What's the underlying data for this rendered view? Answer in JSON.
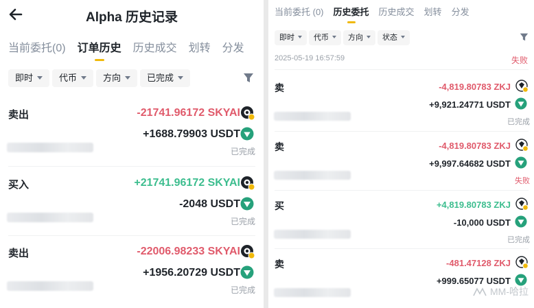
{
  "left": {
    "title": "Alpha 历史记录",
    "tabs": [
      "当前委托(0)",
      "订单历史",
      "历史成交",
      "划转",
      "分发"
    ],
    "active_tab": 1,
    "filters": [
      "即时",
      "代币",
      "方向",
      "已完成"
    ],
    "orders": [
      {
        "side": "卖出",
        "amount": "-21741.96172 SKYAI",
        "usdt": "+1688.79903 USDT",
        "status": "已完成",
        "direction": "sell"
      },
      {
        "side": "买入",
        "amount": "+21741.96172 SKYAI",
        "usdt": "-2048 USDT",
        "status": "已完成",
        "direction": "buy"
      },
      {
        "side": "卖出",
        "amount": "-22006.98233 SKYAI",
        "usdt": "+1956.20729 USDT",
        "status": "已完成",
        "direction": "sell"
      }
    ]
  },
  "right": {
    "tabs": [
      "当前委托 (0)",
      "历史委托",
      "历史成交",
      "划转",
      "分发"
    ],
    "active_tab": 1,
    "filters": [
      "即时",
      "代币",
      "方向",
      "状态"
    ],
    "top_date": "2025-05-19 16:57:59",
    "top_status": "失败",
    "orders": [
      {
        "side": "卖",
        "amount": "-4,819.80783 ZKJ",
        "usdt": "+9,921.24771 USDT",
        "status": "已完成",
        "status_type": "done",
        "direction": "sell"
      },
      {
        "side": "卖",
        "amount": "-4,819.80783 ZKJ",
        "usdt": "+9,997.64682 USDT",
        "status": "失败",
        "status_type": "fail",
        "direction": "sell"
      },
      {
        "side": "买",
        "amount": "+4,819.80783 ZKJ",
        "usdt": "-10,000 USDT",
        "status": "已完成",
        "status_type": "done",
        "direction": "buy"
      },
      {
        "side": "卖",
        "amount": "-481.47128 ZKJ",
        "usdt": "+999.65077 USDT",
        "status": "",
        "status_type": "done",
        "direction": "sell"
      }
    ]
  },
  "watermark": "MM-哈拉",
  "colors": {
    "sell": "#e05a6b",
    "buy": "#3cbd8e",
    "accent": "#f0b90b",
    "muted": "#9aa0a8"
  },
  "icons": {
    "back": "arrow-left-icon",
    "filter": "funnel-icon",
    "token": "token-logo-icon",
    "usdt": "usdt-icon"
  }
}
